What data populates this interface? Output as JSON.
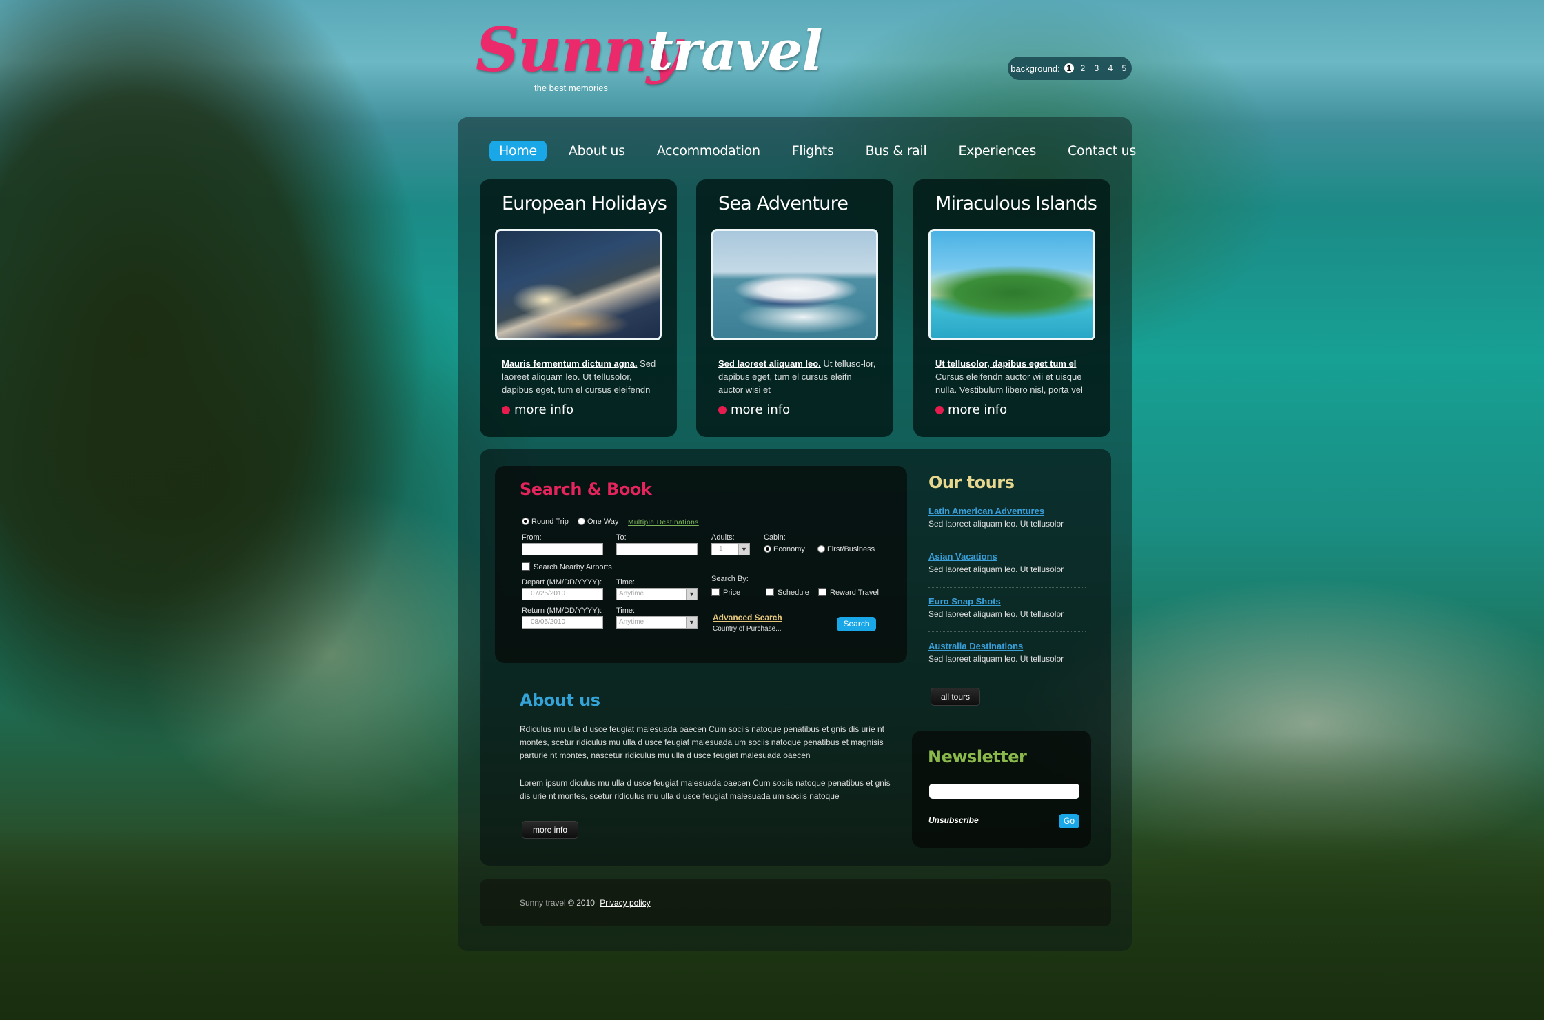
{
  "header": {
    "logo_part1": "Sunny",
    "logo_part2": "travel",
    "tagline": "the best memories",
    "background_switcher": {
      "label": "background:",
      "options": [
        "1",
        "2",
        "3",
        "4",
        "5"
      ],
      "selected": "1"
    }
  },
  "nav": {
    "items": [
      {
        "label": "Home",
        "active": true
      },
      {
        "label": "About us"
      },
      {
        "label": "Accommodation"
      },
      {
        "label": "Flights"
      },
      {
        "label": "Bus & rail"
      },
      {
        "label": "Experiences"
      },
      {
        "label": "Contact us"
      }
    ]
  },
  "features": [
    {
      "title": "European Holidays",
      "image": "coastal-town-night-photo",
      "lead_bold": "Mauris fermentum dictum agna.",
      "lead_text": " Sed laoreet aliquam leo. Ut tellusolor, dapibus eget, tum el cursus eleifendn",
      "more": "more info"
    },
    {
      "title": "Sea Adventure",
      "image": "speedboat-photo",
      "lead_bold": "Sed laoreet aliquam leo.",
      "lead_text": " Ut telluso-lor, dapibus eget, tum el cursus eleifn auctor wisi et",
      "more": "more info"
    },
    {
      "title": "Miraculous Islands",
      "image": "tropical-island-photo",
      "lead_bold": "Ut tellusolor, dapibus eget tum el",
      "lead_text": " Cursus eleifendn auctor wii et uisque nulla. Vestibulum libero nisl, porta vel",
      "more": "more info"
    }
  ],
  "search_book": {
    "title": "Search & Book",
    "trip_types": [
      {
        "label": "Round Trip",
        "checked": true
      },
      {
        "label": "One Way",
        "checked": false
      }
    ],
    "multiple_destinations": "Multiple Destinations",
    "from_label": "From:",
    "from_value": "",
    "to_label": "To:",
    "to_value": "",
    "nearby_airports": "Search Nearby Airports",
    "depart_label": "Depart (MM/DD/YYYY):",
    "depart_value": "07/25/2010",
    "depart_time_label": "Time:",
    "depart_time_value": "Anytime",
    "return_label": "Return (MM/DD/YYYY):",
    "return_value": "08/05/2010",
    "return_time_label": "Time:",
    "return_time_value": "Anytime",
    "adults_label": "Adults:",
    "adults_value": "1",
    "cabin_label": "Cabin:",
    "cabin_options": [
      {
        "label": "Economy",
        "checked": true
      },
      {
        "label": "First/Business",
        "checked": false
      }
    ],
    "search_by_label": "Search By:",
    "search_by_options": [
      "Price",
      "Schedule",
      "Reward Travel"
    ],
    "advanced_search": "Advanced Search",
    "country_of_purchase": "Country of Purchase...",
    "search_button": "Search"
  },
  "about": {
    "title": "About us",
    "paragraphs": [
      "Rdiculus mu ulla d usce feugiat malesuada oaecen Cum sociis natoque penatibus et gnis dis urie nt montes, scetur ridiculus mu ulla d usce feugiat malesuada um sociis natoque penatibus et magnisis parturie nt montes, nascetur ridiculus mu ulla d usce feugiat malesuada oaecen",
      "Lorem ipsum diculus mu ulla d usce feugiat malesuada oaecen Cum sociis natoque penatibus et gnis dis urie nt montes, scetur ridiculus mu ulla d usce feugiat malesuada um sociis natoque"
    ],
    "more_button": "more info"
  },
  "tours": {
    "title": "Our tours",
    "items": [
      {
        "name": "Latin American Adventures",
        "desc": "Sed laoreet aliquam leo. Ut tellusolor"
      },
      {
        "name": "Asian Vacations",
        "desc": "Sed laoreet aliquam leo. Ut tellusolor"
      },
      {
        "name": "Euro Snap Shots",
        "desc": "Sed laoreet aliquam leo. Ut tellusolor"
      },
      {
        "name": "Australia Destinations",
        "desc": "Sed laoreet aliquam leo. Ut tellusolor"
      }
    ],
    "all_tours_button": "all tours"
  },
  "newsletter": {
    "title": "Newsletter",
    "email_value": "",
    "unsubscribe": "Unsubscribe",
    "go_button": "Go"
  },
  "footer": {
    "brand": "Sunny travel",
    "copyright": "© 2010",
    "privacy": "Privacy policy"
  },
  "colors": {
    "accent_blue": "#1aa7e8",
    "brand_pink": "#ea2a6b",
    "search_title": "#e4245c",
    "about_title": "#34a3d8",
    "tours_title": "#e7d78f",
    "newsletter_title": "#8ab84a",
    "tour_link": "#3a9fd9",
    "bullet_red": "#e61c4e"
  }
}
